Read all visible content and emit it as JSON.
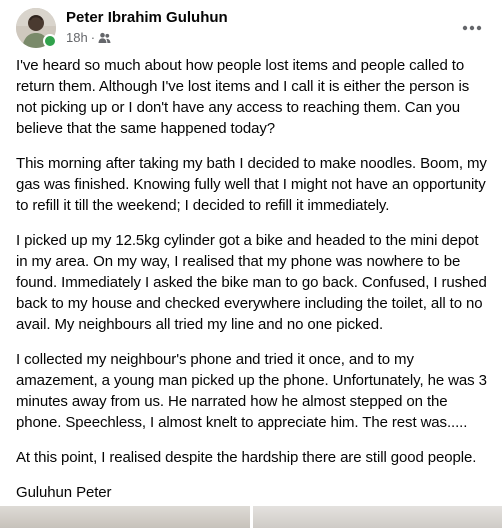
{
  "post": {
    "author": "Peter Ibrahim Guluhun",
    "time": "18h",
    "separator": "·",
    "audience_icon": "friends-icon",
    "more_icon": "more-options-icon",
    "online_color": "#31a24c",
    "paragraphs": [
      "I've heard so much about how people lost items and people called to return them. Although I've lost items and I call it is either the person is not picking up or I don't have any access to reaching them. Can you believe that the same happened today?",
      "This morning after taking my bath I decided to make noodles. Boom, my gas was finished. Knowing fully well that I might not have an opportunity to refill it till the weekend; I decided to refill it immediately.",
      "I picked up my 12.5kg cylinder got a bike and headed to the mini depot in my area. On my way, I realised that my phone was nowhere to be found. Immediately I asked the bike man to go back. Confused, I rushed back to my house and checked everywhere including the toilet, all to no avail. My neighbours all tried my line and no one picked.",
      "I collected my neighbour's phone and tried it once, and to my amazement, a young man picked up the phone. Unfortunately, he was 3 minutes away from us. He narrated how he almost stepped on the phone. Speechless, I almost knelt to appreciate him. The rest was.....",
      "At this point, I realised despite the hardship there are still good people.",
      "Guluhun Peter"
    ]
  }
}
